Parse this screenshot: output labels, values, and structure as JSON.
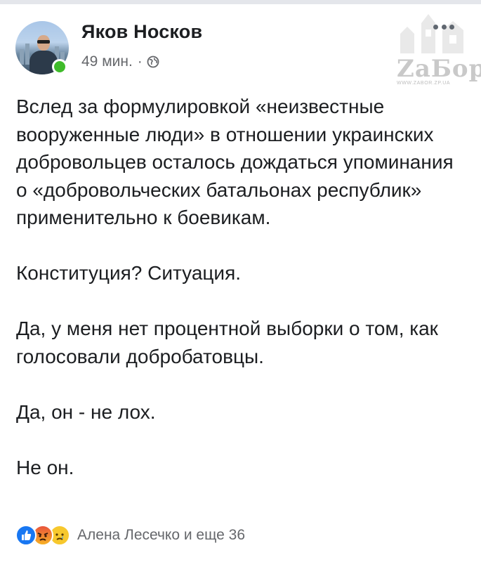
{
  "post": {
    "author": "Яков Носков",
    "time": "49 мин.",
    "separator": "·",
    "privacy_icon": "globe-icon",
    "paragraphs": [
      "Вслед за формулировкой «неизвестные вооруженные люди» в отношении украинских добровольцев осталось дождаться упоминания о «добровольческих батальонах республик» применительно к боевикам.",
      "Конституция? Ситуация.",
      "Да, у меня нет процентной выборки о том, как голосовали добробатовцы.",
      "Да, он - не лох.",
      "Не он."
    ],
    "reactions": {
      "icons": [
        "like-icon",
        "angry-icon",
        "sad-icon"
      ],
      "summary": "Алена Лесечко и еще 36"
    }
  },
  "watermark": {
    "text": "ZaБор",
    "url": "WWW.ZABOR.ZP.UA"
  },
  "colors": {
    "online": "#3fbb2a",
    "like": "#1877f2",
    "meta_text": "#65676b"
  }
}
